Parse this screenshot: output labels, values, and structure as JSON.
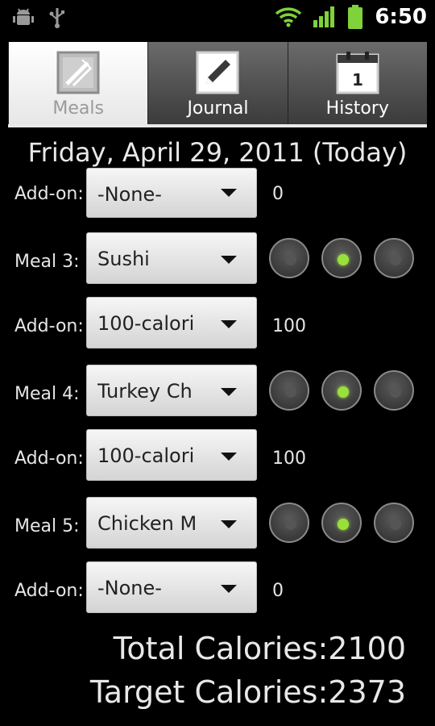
{
  "status_bar": {
    "time": "6:50",
    "left_icons": [
      "android-debug-icon",
      "usb-icon"
    ],
    "right_icons": [
      "wifi-icon",
      "signal-icon",
      "battery-icon"
    ]
  },
  "tabs": [
    {
      "label": "Meals",
      "icon": "fork-knife-icon",
      "selected": true
    },
    {
      "label": "Journal",
      "icon": "pencil-icon",
      "selected": false
    },
    {
      "label": "History",
      "icon": "calendar-icon",
      "selected": false
    }
  ],
  "calendar_icon_day": "1",
  "date": "Friday, April 29, 2011 (Today)",
  "rows": [
    {
      "label": "Add-on:",
      "selection": "-None-",
      "calories": "0",
      "radios": null
    },
    {
      "label": "Meal 3:",
      "selection": "Sushi",
      "calories": "",
      "radios": [
        false,
        true,
        false
      ]
    },
    {
      "label": "Add-on:",
      "selection": "100-calori",
      "calories": "100",
      "radios": null
    },
    {
      "label": "Meal 4:",
      "selection": "Turkey Ch",
      "calories": "",
      "radios": [
        false,
        true,
        false
      ]
    },
    {
      "label": "Add-on:",
      "selection": "100-calori",
      "calories": "100",
      "radios": null
    },
    {
      "label": "Meal 5:",
      "selection": "Chicken M",
      "calories": "",
      "radios": [
        false,
        true,
        false
      ]
    },
    {
      "label": "Add-on:",
      "selection": "-None-",
      "calories": "0",
      "radios": null
    }
  ],
  "totals": {
    "total_calories": "Total Calories:2100",
    "target_calories": "Target Calories:2373"
  },
  "colors": {
    "radio_selected": "#9ae03a",
    "background": "#000000"
  }
}
